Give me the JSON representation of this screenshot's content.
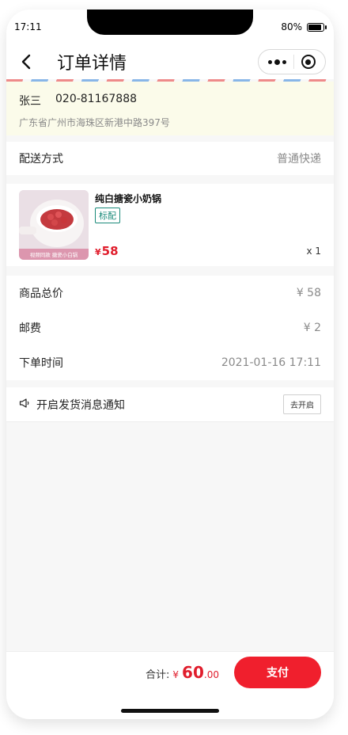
{
  "status_bar": {
    "time": "17:11",
    "battery": "80%",
    "battery_level": 0.8
  },
  "header": {
    "title": "订单详情"
  },
  "address": {
    "name": "张三",
    "phone": "020-81167888",
    "full": "广东省广州市海珠区新港中路397号"
  },
  "shipping": {
    "label": "配送方式",
    "value": "普通快递"
  },
  "product": {
    "name": "纯白搪瓷小奶锅",
    "tag": "标配",
    "currency": "¥",
    "price": "58",
    "qty": "x 1",
    "image_caption": "视频同款 搪瓷小白锅"
  },
  "summary": {
    "total_label": "商品总价",
    "total_value": "¥ 58",
    "shipping_label": "邮费",
    "shipping_value": "¥ 2",
    "time_label": "下单时间",
    "time_value": "2021-01-16 17:11"
  },
  "notify": {
    "label": "开启发货消息通知",
    "button": "去开启"
  },
  "footer": {
    "total_label": "合计:",
    "currency": "¥",
    "amount": "60",
    "cents": ".00",
    "pay_button": "支付"
  }
}
